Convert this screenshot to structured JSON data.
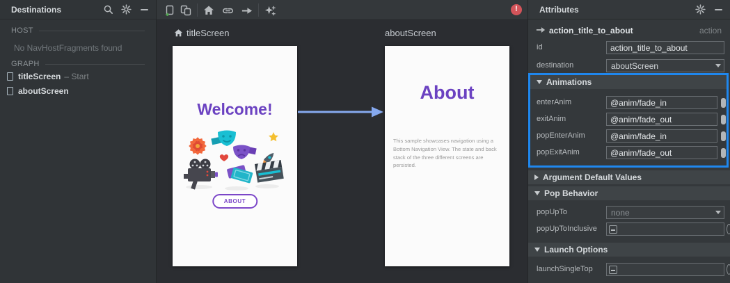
{
  "colors": {
    "accent_blue": "#1f87ee",
    "action_arrow_blue": "#86a9ef",
    "brand_purple": "#6b42c1",
    "error_red": "#d3545a"
  },
  "left_panel": {
    "title": "Destinations",
    "host": {
      "label": "HOST",
      "empty_text": "No NavHostFragments found"
    },
    "graph": {
      "label": "GRAPH",
      "items": [
        {
          "name": "titleScreen",
          "suffix": "– Start"
        },
        {
          "name": "aboutScreen",
          "suffix": ""
        }
      ]
    }
  },
  "toolbar_icons": [
    "new-destination",
    "nested-graph",
    "assign-start",
    "deep-link",
    "action",
    "auto-arrange",
    "error-indicator"
  ],
  "canvas": {
    "screens": [
      {
        "label": "titleScreen",
        "title": "Welcome!",
        "button_label": "ABOUT"
      },
      {
        "label": "aboutScreen",
        "title": "About",
        "body": "This sample showcases navigation using a Bottom Navigation View. The state and back stack of the three different screens are persisted."
      }
    ]
  },
  "attributes": {
    "title": "Attributes",
    "selected_name": "action_title_to_about",
    "selected_type": "action",
    "id_label": "id",
    "id_value": "action_title_to_about",
    "destination_label": "destination",
    "destination_value": "aboutScreen",
    "animations": {
      "title": "Animations",
      "rows": [
        {
          "label": "enterAnim",
          "value": "@anim/fade_in"
        },
        {
          "label": "exitAnim",
          "value": "@anim/fade_out"
        },
        {
          "label": "popEnterAnim",
          "value": "@anim/fade_in"
        },
        {
          "label": "popExitAnim",
          "value": "@anim/fade_out"
        }
      ]
    },
    "argument_defaults": {
      "title": "Argument Default Values"
    },
    "pop_behavior": {
      "title": "Pop Behavior",
      "pop_up_to_label": "popUpTo",
      "pop_up_to_value": "none",
      "pop_up_to_inclusive_label": "popUpToInclusive"
    },
    "launch_options": {
      "title": "Launch Options",
      "launch_single_top_label": "launchSingleTop"
    }
  }
}
